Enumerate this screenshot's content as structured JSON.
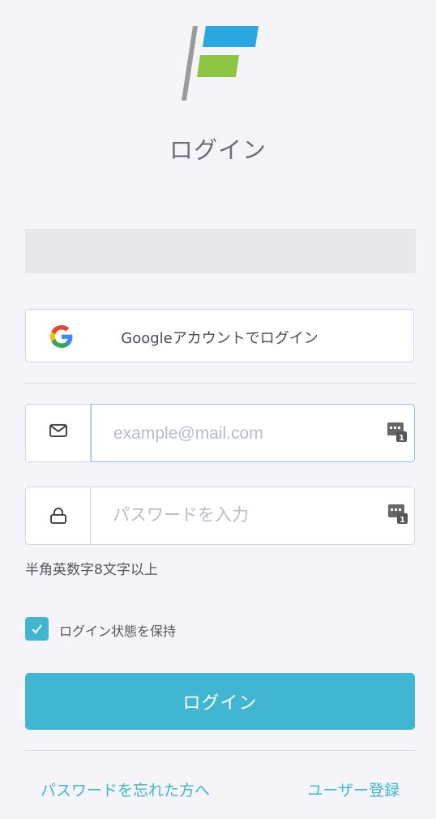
{
  "header": {
    "title": "ログイン",
    "logo_colors": {
      "top": "#2aa6e0",
      "bottom": "#8bc541",
      "bar": "#9a9a9a"
    }
  },
  "google": {
    "label": "Googleアカウントでログイン",
    "icon": "google-g-icon"
  },
  "email": {
    "icon": "envelope-icon",
    "placeholder": "example@mail.com",
    "value": ""
  },
  "password": {
    "icon": "lock-icon",
    "placeholder": "パスワードを入力",
    "value": "",
    "hint": "半角英数字8文字以上"
  },
  "remember": {
    "label": "ログイン状態を保持",
    "checked": true
  },
  "submit": {
    "label": "ログイン"
  },
  "links": {
    "forgot": "パスワードを忘れた方へ",
    "register": "ユーザー登録"
  },
  "colors": {
    "accent": "#41b6d2",
    "background": "#f4f4f9"
  }
}
